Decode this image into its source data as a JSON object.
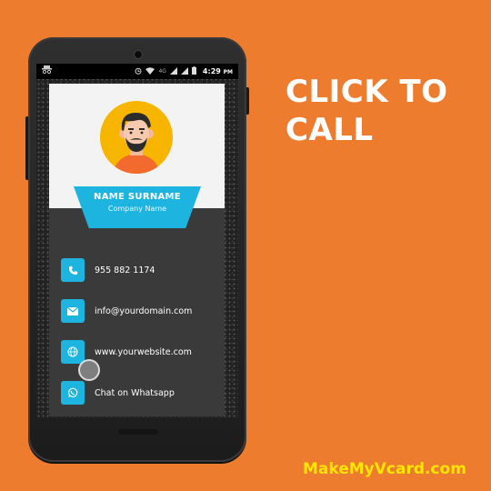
{
  "headline": {
    "line1": "CLICK TO",
    "line2": "CALL"
  },
  "brand": "MakeMyVcard.com",
  "statusbar": {
    "time": "4:29",
    "network": "4G",
    "period": "PM"
  },
  "card": {
    "name": "NAME SURNAME",
    "company": "Company Name",
    "contacts": [
      {
        "icon": "phone-icon",
        "label": "955 882 1174"
      },
      {
        "icon": "email-icon",
        "label": "info@yourdomain.com"
      },
      {
        "icon": "globe-icon",
        "label": "www.yourwebsite.com"
      },
      {
        "icon": "whatsapp-icon",
        "label": "Chat on Whatsapp"
      }
    ]
  },
  "colors": {
    "background": "#ee7c2f",
    "accent": "#1db4e0",
    "brand_text": "#ffe600",
    "avatar_bg": "#f7b500"
  }
}
